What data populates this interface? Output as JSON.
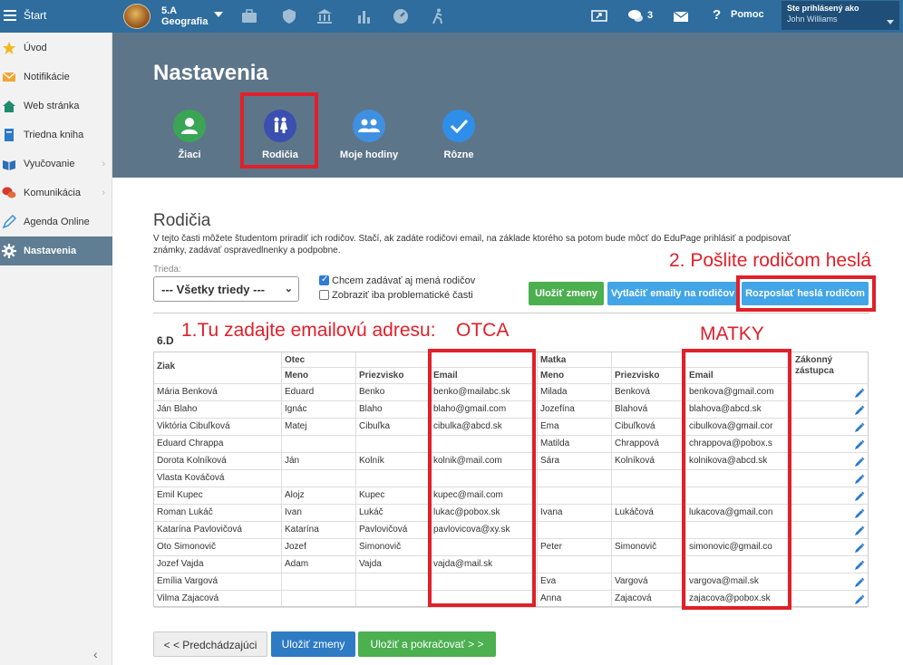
{
  "topbar": {
    "start_label": "Štart",
    "class_name": "5.A",
    "subject": "Geografia",
    "message_count": "3",
    "help_label": "Pomoc",
    "logged_in_label": "Ste prihlásený ako",
    "user_name": "John Williams"
  },
  "sidebar": {
    "items": [
      {
        "label": "Úvod",
        "icon": "star-icon"
      },
      {
        "label": "Notifikácie",
        "icon": "envelope-icon"
      },
      {
        "label": "Web stránka",
        "icon": "home-icon"
      },
      {
        "label": "Triedna kniha",
        "icon": "book-icon"
      },
      {
        "label": "Vyučovanie",
        "icon": "open-book-icon"
      },
      {
        "label": "Komunikácia",
        "icon": "chat-icon"
      },
      {
        "label": "Agenda Online",
        "icon": "pen-icon"
      },
      {
        "label": "Nastavenia",
        "icon": "gear-icon"
      }
    ]
  },
  "header": {
    "title": "Nastavenia",
    "tabs": [
      {
        "label": "Žiaci",
        "color": "#3aa655"
      },
      {
        "label": "Rodičia",
        "color": "#3b4fb0"
      },
      {
        "label": "Moje hodiny",
        "color": "#3f90e0"
      },
      {
        "label": "Rôzne",
        "color": "#2f8fe8"
      }
    ]
  },
  "main": {
    "title": "Rodičia",
    "description": "V tejto časti môžete študentom priradiť ich rodičov. Stačí, ak zadáte rodičovi email, na základe ktorého sa potom bude môcť do EduPage prihlásiť a podpisovať známky, zadávať ospravedlnenky a podpobne.",
    "class_label": "Trieda:",
    "class_select": "--- Všetky triedy ---",
    "checkbox_names": "Chcem zadávať aj mená rodičov",
    "checkbox_problems": "Zobraziť iba problematické časti",
    "btn_save": "Uložiť zmeny",
    "btn_print": "Vytlačiť emaily na rodičov",
    "btn_send": "Rozposlať heslá rodičom",
    "group": "6.D"
  },
  "annotations": {
    "step1": "1.Tu zadajte emailovú adresu:",
    "otca": "OTCA",
    "step2": "2. Pošlite rodičom heslá",
    "matky": "MATKY"
  },
  "table": {
    "headers": {
      "student": "Žiak",
      "father": "Otec",
      "mother": "Matka",
      "first_name": "Meno",
      "last_name": "Priezvisko",
      "email": "Email",
      "guardian": "Zákonný zástupca"
    },
    "rows": [
      {
        "student": "Mária Benková",
        "f_first": "Eduard",
        "f_last": "Benko",
        "f_email": "benko@mailabc.sk",
        "m_first": "Milada",
        "m_last": "Benková",
        "m_email": "benkova@gmail.com"
      },
      {
        "student": "Ján Blaho",
        "f_first": "Ignác",
        "f_last": "Blaho",
        "f_email": "blaho@gmail.com",
        "m_first": "Jozefína",
        "m_last": "Blahová",
        "m_email": "blahova@abcd.sk"
      },
      {
        "student": "Viktória Cibuľková",
        "f_first": "Matej",
        "f_last": "Cibuľka",
        "f_email": "cibulka@abcd.sk",
        "m_first": "Ema",
        "m_last": "Cibuľková",
        "m_email": "cibulkova@gmail.cor"
      },
      {
        "student": "Eduard Chrappa",
        "f_first": "",
        "f_last": "",
        "f_email": "",
        "m_first": "Matilda",
        "m_last": "Chrappová",
        "m_email": "chrappova@pobox.s"
      },
      {
        "student": "Dorota Kolníková",
        "f_first": "Ján",
        "f_last": "Kolník",
        "f_email": "kolnik@mail.com",
        "m_first": "Sára",
        "m_last": "Kolníková",
        "m_email": "kolnikova@abcd.sk"
      },
      {
        "student": "Vlasta Kováčová",
        "f_first": "",
        "f_last": "",
        "f_email": "",
        "m_first": "",
        "m_last": "",
        "m_email": ""
      },
      {
        "student": "Emil Kupec",
        "f_first": "Alojz",
        "f_last": "Kupec",
        "f_email": "kupec@mail.com",
        "m_first": "",
        "m_last": "",
        "m_email": ""
      },
      {
        "student": "Roman Lukáč",
        "f_first": "Ivan",
        "f_last": "Lukáč",
        "f_email": "lukac@pobox.sk",
        "m_first": "Ivana",
        "m_last": "Lukáčová",
        "m_email": "lukacova@gmail.con"
      },
      {
        "student": "Katarína Pavlovičová",
        "f_first": "Katarína",
        "f_last": "Pavlovičová",
        "f_email": "pavlovicova@xy.sk",
        "m_first": "",
        "m_last": "",
        "m_email": ""
      },
      {
        "student": "Oto Šimonovič",
        "f_first": "Jozef",
        "f_last": "Šimonovič",
        "f_email": "",
        "m_first": "Peter",
        "m_last": "Šimonovič",
        "m_email": "simonovic@gmail.co"
      },
      {
        "student": "Jozef Vajda",
        "f_first": "Adam",
        "f_last": "Vajda",
        "f_email": "vajda@mail.sk",
        "m_first": "",
        "m_last": "",
        "m_email": ""
      },
      {
        "student": "Emília Vargová",
        "f_first": "",
        "f_last": "",
        "f_email": "",
        "m_first": "Eva",
        "m_last": "Vargová",
        "m_email": "vargova@mail.sk"
      },
      {
        "student": "Vilma Zajacová",
        "f_first": "",
        "f_last": "",
        "f_email": "",
        "m_first": "Anna",
        "m_last": "Zajacová",
        "m_email": "zajacova@pobox.sk"
      }
    ]
  },
  "footer": {
    "prev": "< < Predchádzajúci",
    "save": "Uložiť zmeny",
    "save_next": "Uložiť a pokračovať > >"
  }
}
